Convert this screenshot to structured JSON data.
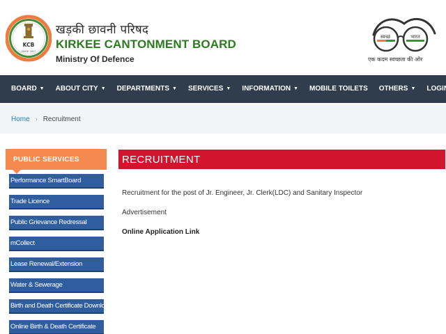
{
  "header": {
    "hindi_title": "खड़की छावनी परिषद",
    "title": "KIRKEE CANTONMENT BOARD",
    "subtitle": "Ministry Of Defence",
    "logo_text": "KCB",
    "logo_small_text": "SINCE 1817",
    "swachh_left": "स्वच्छ",
    "swachh_right": "भारत",
    "swachh_tagline": "एक कदम स्वच्छता की ओर"
  },
  "nav": {
    "items": [
      {
        "label": "BOARD",
        "dropdown": true
      },
      {
        "label": "ABOUT CITY",
        "dropdown": true
      },
      {
        "label": "DEPARTMENTS",
        "dropdown": true
      },
      {
        "label": "SERVICES",
        "dropdown": true
      },
      {
        "label": "INFORMATION",
        "dropdown": true
      },
      {
        "label": "MOBILE TOILETS",
        "dropdown": false
      },
      {
        "label": "OTHERS",
        "dropdown": true
      },
      {
        "label": "LOGIN",
        "dropdown": true
      }
    ]
  },
  "breadcrumb": {
    "home": "Home",
    "separator": "›",
    "current": "Recruitment"
  },
  "sidebar": {
    "heading": "PUBLIC SERVICES",
    "items": [
      "Performance SmartBoard",
      "Trade Licence",
      "Public Grievance Redressal",
      "mCollect",
      "Lease Renewal/Extension",
      "Water & Sewerage",
      "Birth and Death Certificate Download",
      "Online Birth & Death Certificate"
    ]
  },
  "content": {
    "heading": "RECRUITMENT",
    "line1": "Recruitment for the post of Jr. Engineer, Jr. Clerk(LDC) and Sanitary Inspector",
    "line2": "Advertisement",
    "link": "Online Application Link"
  },
  "colors": {
    "nav_bg": "#2f3d4c",
    "title_green": "#2c7a1f",
    "sidebar_head": "#f48a4f",
    "sidebar_item": "#2f5d9e",
    "content_head": "#d2152e",
    "breadcrumb_link": "#1f7fbf"
  }
}
